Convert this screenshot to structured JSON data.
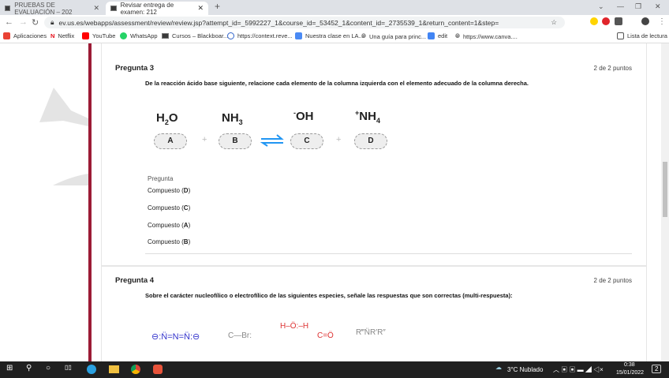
{
  "browser": {
    "tabs": [
      {
        "label": "PRUEBAS DE EVALUACIÓN – 202"
      },
      {
        "label": "Revisar entrega de examen: 212"
      }
    ],
    "url": "ev.us.es/webapps/assessment/review/review.jsp?attempt_id=_5992227_1&course_id=_53452_1&content_id=_2735539_1&return_content=1&step=",
    "bookmarks": [
      "Aplicaciones",
      "Netflix",
      "YouTube",
      "WhatsApp",
      "Cursos – Blackboar...",
      "https://context.reve...",
      "Nuestra clase en LA...",
      "Una guía para princ...",
      "edit",
      "https://www.canva...."
    ],
    "reading_list": "Lista de lectura"
  },
  "q3": {
    "title": "Pregunta 3",
    "points": "2 de 2 puntos",
    "text": "De la reacción ácido base siguiente, relacione cada elemento de la columna izquierda con el elemento adecuado de la columna derecha.",
    "molecules": [
      {
        "main": "H",
        "sub": "2",
        "end": "O",
        "label": "A"
      },
      {
        "main": "NH",
        "sub": "3",
        "end": "",
        "label": "B"
      },
      {
        "sup": "-",
        "main": "OH",
        "label": "C"
      },
      {
        "sup": "+",
        "main": "NH",
        "sub": "4",
        "label": "D"
      }
    ],
    "plus": "+",
    "header": "Pregunta",
    "answers": [
      {
        "pre": "Compuesto (",
        "key": "D",
        "post": ")"
      },
      {
        "pre": "Compuesto (",
        "key": "C",
        "post": ")"
      },
      {
        "pre": "Compuesto (",
        "key": "A",
        "post": ")"
      },
      {
        "pre": "Compuesto (",
        "key": "B",
        "post": ")"
      }
    ]
  },
  "q4": {
    "title": "Pregunta 4",
    "points": "2 de 2 puntos",
    "text": "Sobre el carácter nucleofílico o electrofílico de las siguientes especies, señale las respuestas que son correctas (multi-respuesta):",
    "species": [
      "⊖:N̈=N=N̈:⊖",
      "C—Br:",
      "H–Ö:–H",
      "C=Ö",
      "R‴N̈R′R″"
    ]
  },
  "taskbar": {
    "weather": "3°C  Nublado",
    "time": "0:38",
    "date": "15/01/2022",
    "notifications": "2"
  },
  "colors": {
    "accent": "#9c1b35",
    "arrow": "#2196f3"
  }
}
